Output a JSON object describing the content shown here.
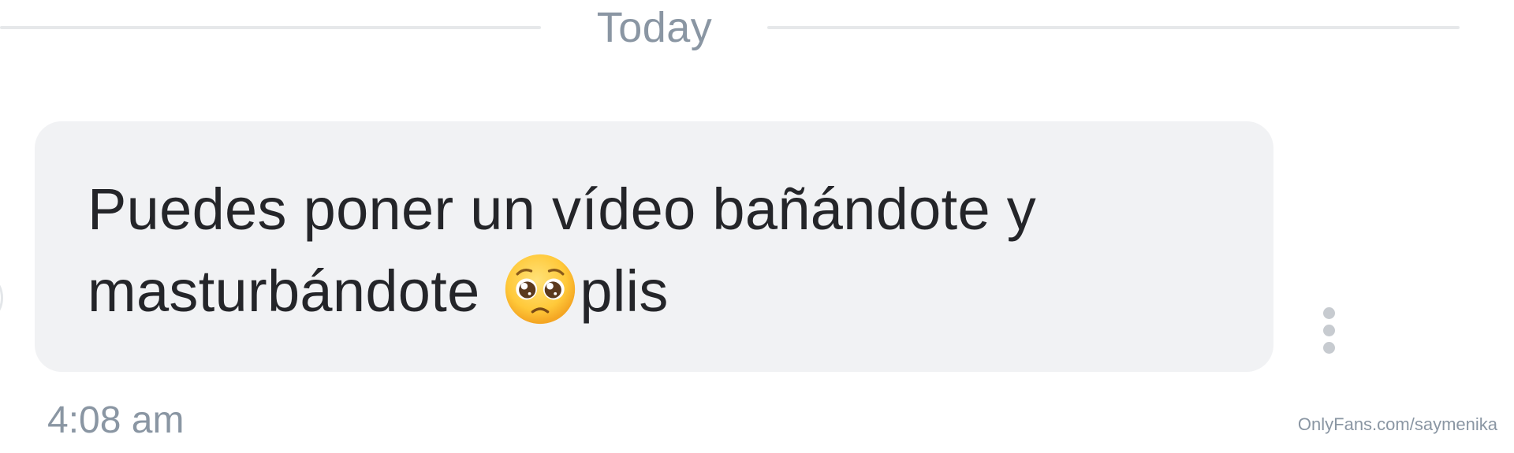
{
  "date_divider": {
    "label": "Today"
  },
  "message": {
    "line1": "Puedes poner un vídeo bañándote y",
    "line2_before_emoji": "masturbándote ",
    "emoji_icon": "pleading-face-emoji",
    "line2_after_emoji": "plis",
    "timestamp": "4:08 am",
    "bubble_color": "#f1f2f4",
    "text_color": "#242529"
  },
  "actions": {
    "more_icon": "vertical-ellipsis-icon"
  },
  "watermark": {
    "text": "OnlyFans.com/saymenika"
  }
}
